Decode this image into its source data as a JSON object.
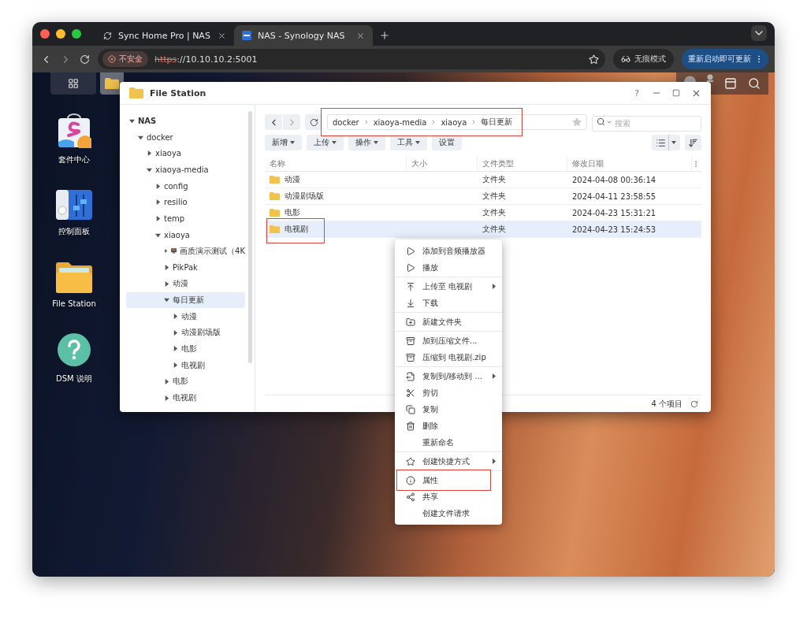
{
  "browser": {
    "tabs": [
      {
        "title": "Sync Home Pro | NAS",
        "kind": "sync",
        "selected": false
      },
      {
        "title": "NAS - Synology NAS",
        "kind": "dsm",
        "selected": true
      }
    ],
    "security": "不安全",
    "url_scheme": "https",
    "url_rest": "://10.10.10.2:5001",
    "incognito": "无痕模式",
    "update": "重新启动即可更新"
  },
  "desktop": {
    "icons": [
      {
        "label": "套件中心",
        "kind": "package"
      },
      {
        "label": "控制面板",
        "kind": "control"
      },
      {
        "label": "File Station",
        "kind": "folder"
      },
      {
        "label": "DSM 说明",
        "kind": "help"
      }
    ]
  },
  "file_station": {
    "title": "File Station",
    "help_button": "?",
    "tree": [
      {
        "label": "NAS",
        "expanded": true,
        "selected": false,
        "children": [
          {
            "label": "docker",
            "expanded": true,
            "selected": false,
            "children": [
              {
                "label": "xiaoya",
                "expanded": false,
                "selected": false
              },
              {
                "label": "xiaoya-media",
                "expanded": true,
                "selected": false,
                "children": [
                  {
                    "label": "config",
                    "expanded": false,
                    "selected": false
                  },
                  {
                    "label": "resilio",
                    "expanded": false,
                    "selected": false
                  },
                  {
                    "label": "temp",
                    "expanded": false,
                    "selected": false
                  },
                  {
                    "label": "xiaoya",
                    "expanded": true,
                    "selected": false,
                    "children": [
                      {
                        "label": "画质演示测试（4K",
                        "kind": "monitor",
                        "expanded": false,
                        "selected": false
                      },
                      {
                        "label": "PikPak",
                        "expanded": false,
                        "selected": false
                      },
                      {
                        "label": "动漫",
                        "expanded": false,
                        "selected": false
                      },
                      {
                        "label": "每日更新",
                        "expanded": true,
                        "selected": true,
                        "children": [
                          {
                            "label": "动漫",
                            "expanded": false,
                            "selected": false
                          },
                          {
                            "label": "动漫剧场版",
                            "expanded": false,
                            "selected": false
                          },
                          {
                            "label": "电影",
                            "expanded": false,
                            "selected": false
                          },
                          {
                            "label": "电视剧",
                            "expanded": false,
                            "selected": false
                          }
                        ]
                      },
                      {
                        "label": "电影",
                        "expanded": false,
                        "selected": false
                      },
                      {
                        "label": "电视剧",
                        "expanded": false,
                        "selected": false
                      }
                    ]
                  }
                ]
              }
            ]
          }
        ]
      }
    ],
    "path": {
      "segments": [
        "docker",
        "xiaoya-media",
        "xiaoya",
        "每日更新"
      ],
      "annotated": true
    },
    "search": {
      "placeholder": "搜索"
    },
    "toolbar": [
      {
        "label": "新增",
        "dropdown": true
      },
      {
        "label": "上传",
        "dropdown": true
      },
      {
        "label": "操作",
        "dropdown": true
      },
      {
        "label": "工具",
        "dropdown": true
      },
      {
        "label": "设置",
        "dropdown": false
      }
    ],
    "columns": [
      "名称",
      "大小",
      "文件类型",
      "修改日期"
    ],
    "rows": [
      {
        "name": "动漫",
        "type": "文件夹",
        "modified": "2024-04-08 00:36:14",
        "selected": false,
        "annotated": false
      },
      {
        "name": "动漫剧场版",
        "type": "文件夹",
        "modified": "2024-04-11 23:58:55",
        "selected": false,
        "annotated": false
      },
      {
        "name": "电影",
        "type": "文件夹",
        "modified": "2024-04-23 15:31:21",
        "selected": false,
        "annotated": false
      },
      {
        "name": "电视剧",
        "type": "文件夹",
        "modified": "2024-04-23 15:24:53",
        "selected": true,
        "annotated": true
      }
    ],
    "status": "4 个项目"
  },
  "context_menu": {
    "groups": [
      [
        {
          "label": "添加到音频播放器",
          "kind": "play",
          "submenu": false,
          "annotated": false
        },
        {
          "label": "播放",
          "kind": "play",
          "submenu": false,
          "annotated": false
        }
      ],
      [
        {
          "label": "上传至 电视剧",
          "kind": "upload",
          "submenu": true,
          "annotated": false
        },
        {
          "label": "下载",
          "kind": "download",
          "submenu": false,
          "annotated": false
        }
      ],
      [
        {
          "label": "新建文件夹",
          "kind": "newfolder",
          "submenu": false,
          "annotated": false
        }
      ],
      [
        {
          "label": "加到压缩文件...",
          "kind": "archive",
          "submenu": false,
          "annotated": false
        },
        {
          "label": "压缩到 电视剧.zip",
          "kind": "archive",
          "submenu": false,
          "annotated": false
        }
      ],
      [
        {
          "label": "复制到/移动到 ...",
          "kind": "copymove",
          "submenu": true,
          "annotated": false
        },
        {
          "label": "剪切",
          "kind": "cut",
          "submenu": false,
          "annotated": false
        },
        {
          "label": "复制",
          "kind": "copy",
          "submenu": false,
          "annotated": false
        },
        {
          "label": "删除",
          "kind": "delete",
          "submenu": false,
          "annotated": false
        },
        {
          "label": "重新命名",
          "kind": "plain",
          "submenu": false,
          "annotated": false
        }
      ],
      [
        {
          "label": "创建快捷方式",
          "kind": "shortcut",
          "submenu": true,
          "annotated": false
        }
      ],
      [
        {
          "label": "属性",
          "kind": "info",
          "submenu": false,
          "annotated": true
        },
        {
          "label": "共享",
          "kind": "share",
          "submenu": false,
          "annotated": false
        },
        {
          "label": "创建文件请求",
          "kind": "plain",
          "submenu": false,
          "annotated": false
        }
      ]
    ]
  }
}
